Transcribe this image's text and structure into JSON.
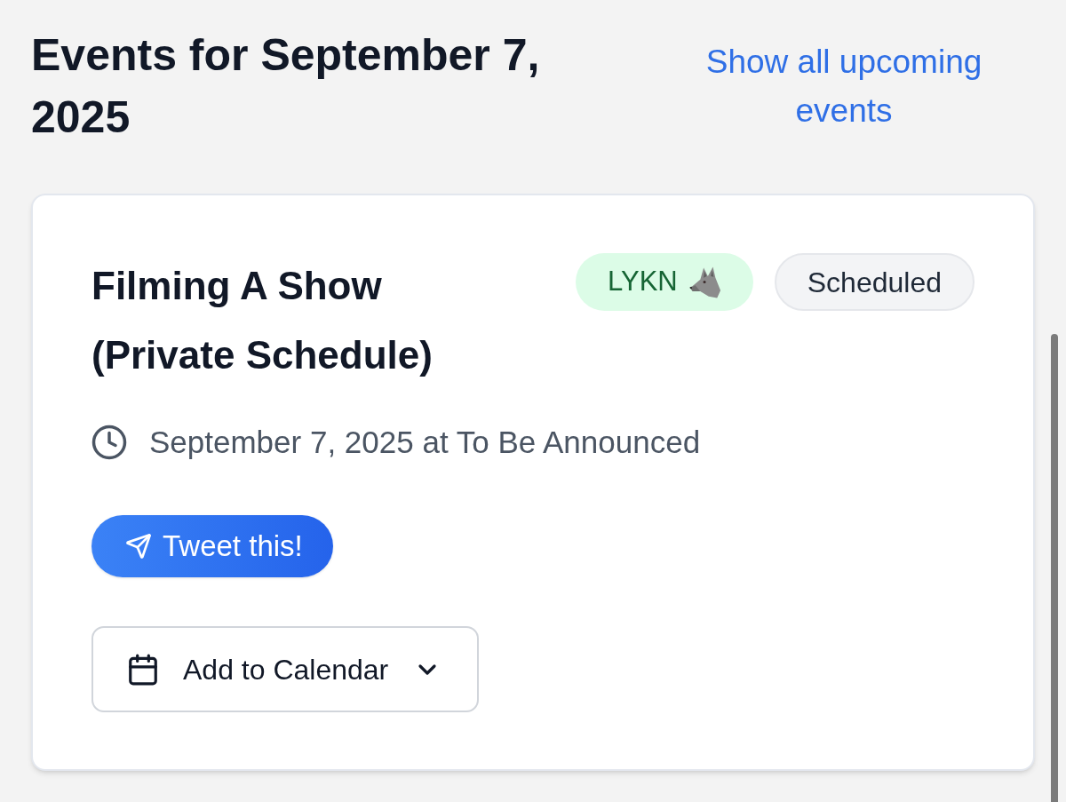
{
  "header": {
    "title": "Events for September 7, 2025",
    "link": "Show all upcoming events"
  },
  "event": {
    "title": "Filming A Show (Private Schedule)",
    "tags": [
      {
        "label": "LYKN",
        "kind": "group"
      },
      {
        "label": "Scheduled",
        "kind": "status"
      }
    ],
    "datetime": "September 7, 2025 at To Be Announced",
    "buttons": [
      {
        "label": "Tweet this!",
        "kind": "share"
      },
      {
        "label": "Add to Calendar",
        "kind": "dropdown"
      }
    ]
  }
}
